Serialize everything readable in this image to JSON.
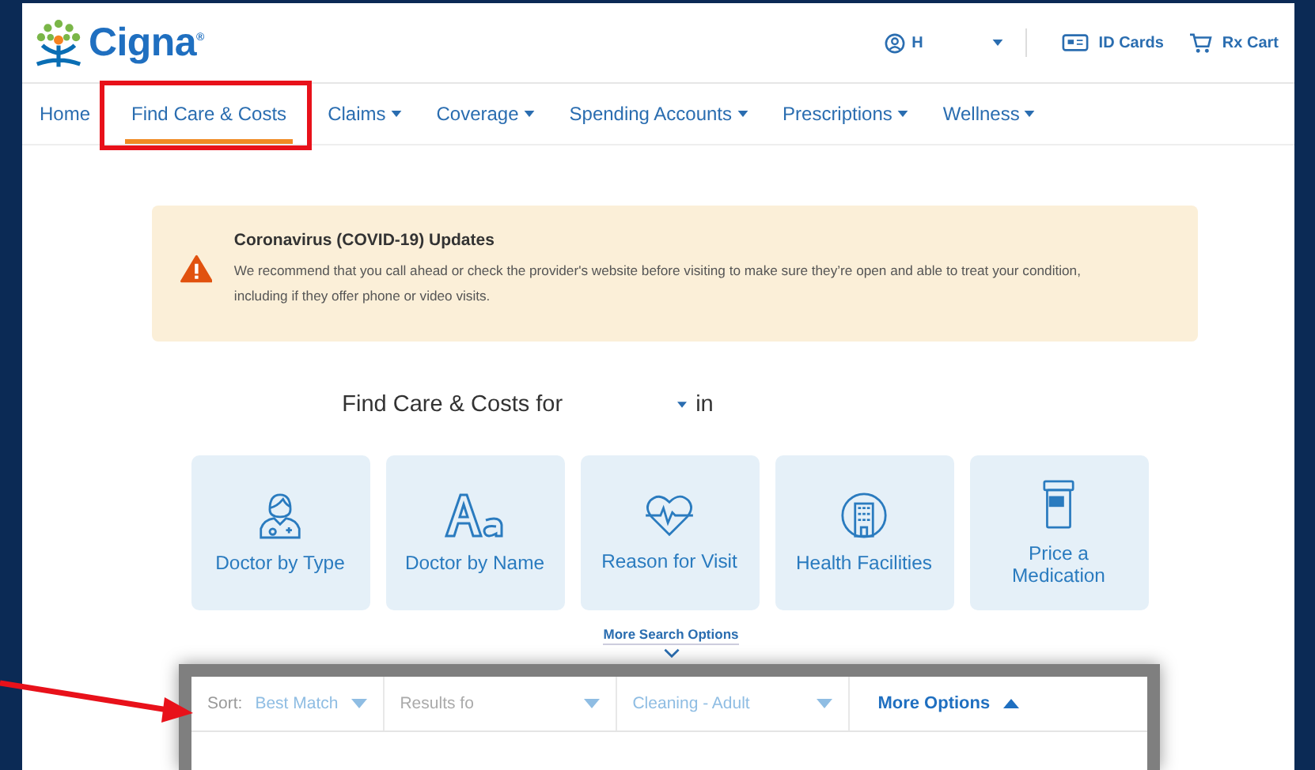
{
  "header": {
    "logo": "Cigna",
    "logo_mark": "®",
    "user": "H",
    "links": [
      {
        "kind": "id-card",
        "label": "ID Cards"
      },
      {
        "kind": "cart",
        "label": "Rx Cart"
      }
    ]
  },
  "nav": [
    {
      "label": "Home",
      "selected": false,
      "dropdown": false
    },
    {
      "label": "Find Care & Costs",
      "selected": true,
      "dropdown": false
    },
    {
      "label": "Claims",
      "selected": false,
      "dropdown": true
    },
    {
      "label": "Coverage",
      "selected": false,
      "dropdown": true
    },
    {
      "label": "Spending Accounts",
      "selected": false,
      "dropdown": true
    },
    {
      "label": "Prescriptions",
      "selected": false,
      "dropdown": true
    },
    {
      "label": "Wellness",
      "selected": false,
      "dropdown": true
    }
  ],
  "alert": {
    "title": "Coronavirus (COVID-19) Updates",
    "message": "We recommend that you call ahead or check the provider's website before visiting to make sure they’re open and able to treat your condition, including if they offer phone or video visits."
  },
  "search_heading": {
    "prefix": "Find Care & Costs for",
    "suffix": "in"
  },
  "tiles": [
    {
      "kind": "doctor",
      "label": "Doctor by Type"
    },
    {
      "kind": "letters",
      "label": "Doctor by Name"
    },
    {
      "kind": "heart",
      "label": "Reason for Visit"
    },
    {
      "kind": "building",
      "label": "Health Facilities"
    },
    {
      "kind": "pill-bottle",
      "label": "Price a Medication"
    }
  ],
  "more_search_options": "More Search Options",
  "filters": [
    {
      "kind": "sort",
      "label": "Sort:",
      "value": "Best Match"
    },
    {
      "kind": "dropdown",
      "value": "Results fo",
      "muted": true
    },
    {
      "kind": "dropdown",
      "value": "Cleaning - Adult",
      "muted": false
    },
    {
      "kind": "toggle",
      "value": "More Options",
      "expanded": true
    }
  ]
}
